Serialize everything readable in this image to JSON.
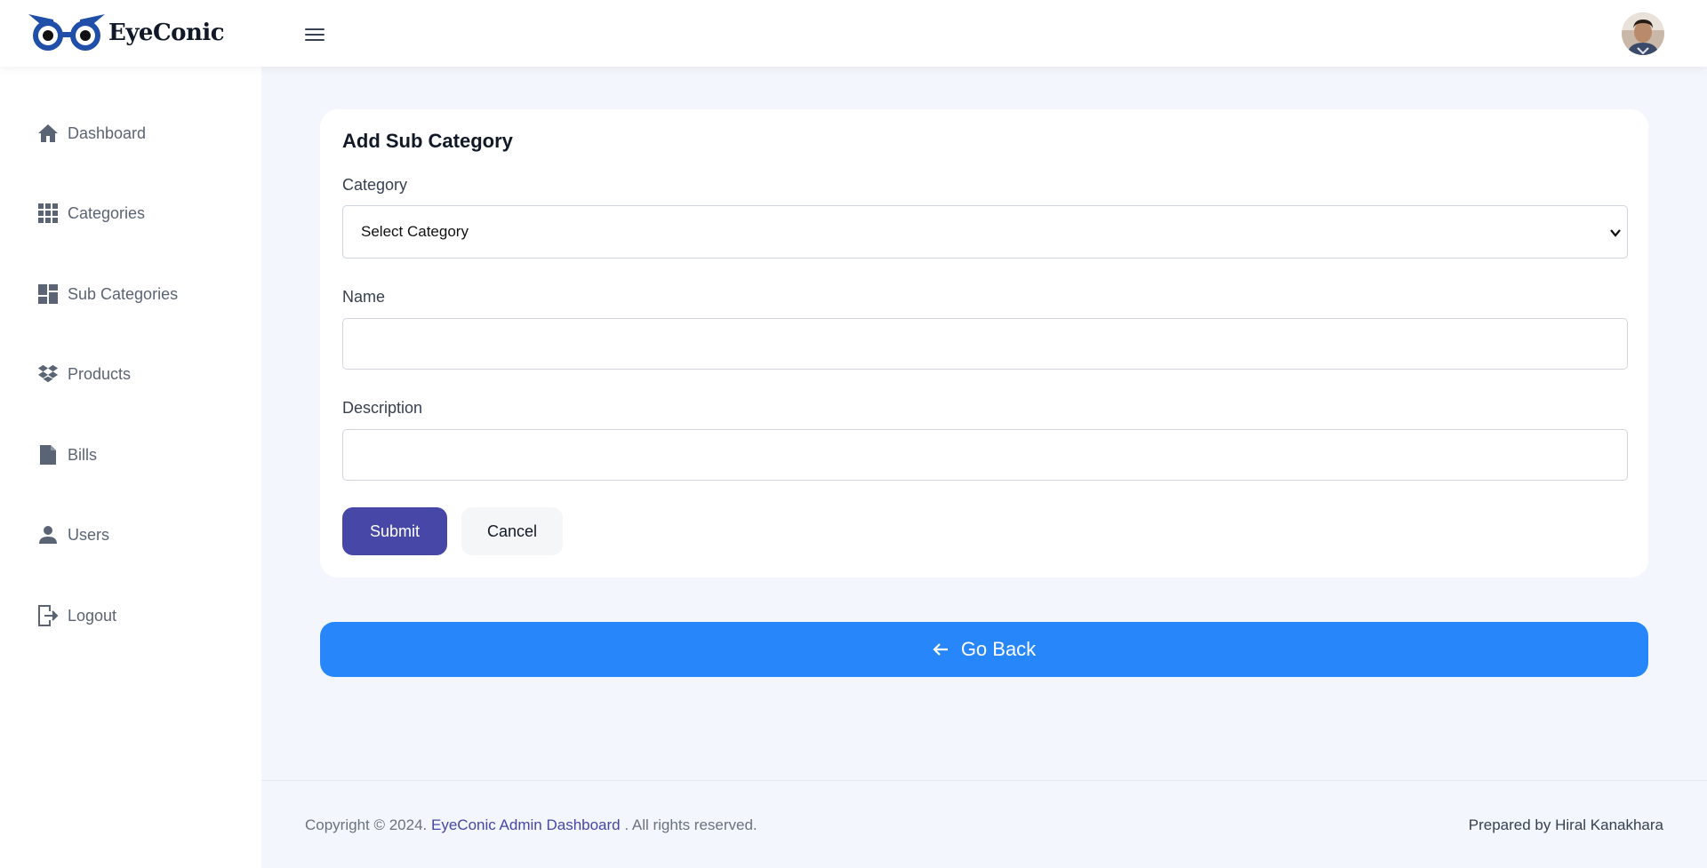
{
  "header": {
    "logo_text": "EyeConic",
    "menu_icon": "hamburger-menu-icon",
    "avatar_icon": "user-avatar"
  },
  "sidebar": {
    "items": [
      {
        "label": "Dashboard",
        "icon": "home-icon"
      },
      {
        "label": "Categories",
        "icon": "grid-icon"
      },
      {
        "label": "Sub Categories",
        "icon": "dashboard-tiles-icon"
      },
      {
        "label": "Products",
        "icon": "boxes-icon"
      },
      {
        "label": "Bills",
        "icon": "file-icon"
      },
      {
        "label": "Users",
        "icon": "user-icon"
      },
      {
        "label": "Logout",
        "icon": "logout-icon"
      }
    ]
  },
  "form": {
    "title": "Add Sub Category",
    "category_label": "Category",
    "category_selected": "Select Category",
    "name_label": "Name",
    "name_value": "",
    "description_label": "Description",
    "description_value": "",
    "submit_label": "Submit",
    "cancel_label": "Cancel"
  },
  "go_back_label": "Go Back",
  "footer": {
    "copyright_prefix": "Copyright © 2024.",
    "link_text": "EyeConic Admin Dashboard",
    "copyright_suffix": ". All rights reserved.",
    "prepared_by": "Prepared by Hiral Kanakhara"
  },
  "colors": {
    "primary": "#4747a8",
    "go_back": "#2787fa",
    "page_bg": "#f3f6fc"
  }
}
